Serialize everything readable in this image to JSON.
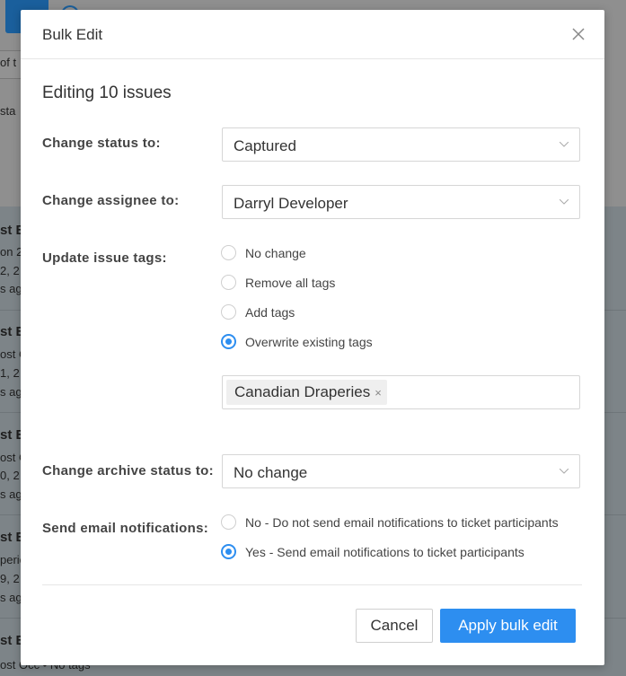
{
  "background": {
    "partial_texts": [
      "of t",
      "sta",
      "st E",
      "on 2",
      "2, 2",
      "s ago",
      "st E",
      "ost C",
      "1, 2",
      "s ago",
      "st E",
      "ost C",
      "0, 2",
      "s ago",
      "st E",
      "perie",
      "9, 2",
      "s ago",
      "st E",
      "ost Occ • No tags"
    ]
  },
  "modal": {
    "title": "Bulk Edit",
    "subtitle": "Editing 10 issues",
    "status": {
      "label": "Change status to:",
      "value": "Captured"
    },
    "assignee": {
      "label": "Change assignee to:",
      "value": "Darryl Developer"
    },
    "tags": {
      "label": "Update issue tags:",
      "options": [
        "No change",
        "Remove all tags",
        "Add tags",
        "Overwrite existing tags"
      ],
      "selected": "Overwrite existing tags",
      "chips": [
        "Canadian Draperies"
      ]
    },
    "archive": {
      "label": "Change archive status to:",
      "value": "No change"
    },
    "email": {
      "label": "Send email notifications:",
      "options": [
        "No - Do not send email notifications to ticket participants",
        "Yes - Send email notifications to ticket participants"
      ],
      "selected": "Yes - Send email notifications to ticket participants"
    },
    "buttons": {
      "cancel": "Cancel",
      "apply": "Apply bulk edit"
    },
    "colors": {
      "accent": "#2d8ef0",
      "overlay": "#8a8a8a"
    }
  }
}
